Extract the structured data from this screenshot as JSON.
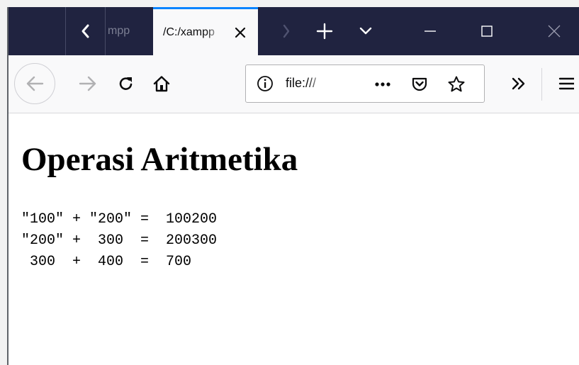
{
  "browser": {
    "tabs": [
      {
        "label": "mpp",
        "active": false
      },
      {
        "label": "/C:/xampp",
        "active": true
      }
    ],
    "url_text": "file:///",
    "icons": {
      "scroll_left": "chevron-left-icon",
      "tab_close": "close-icon",
      "scroll_right": "chevron-right-icon",
      "new_tab": "plus-icon",
      "tab_list": "chevron-down-icon",
      "minimize": "minimize-icon",
      "maximize": "maximize-icon",
      "close_window": "close-window-icon",
      "back": "back-arrow-icon",
      "forward": "forward-arrow-icon",
      "reload": "reload-icon",
      "home": "home-icon",
      "site_info": "info-icon",
      "page_actions": "more-dots-icon",
      "pocket": "pocket-icon",
      "bookmark": "star-icon",
      "overflow": "double-chevron-icon",
      "menu": "hamburger-menu-icon"
    },
    "colors": {
      "tabstrip": "#202340",
      "active_tab_accent": "#0a84ff",
      "toolbar": "#f9f9fa"
    }
  },
  "page": {
    "heading": "Operasi Aritmetika",
    "output_lines": [
      "\"100\" + \"200\" =  100200",
      "\"200\" +  300  =  200300",
      " 300  +  400  =  700"
    ]
  }
}
